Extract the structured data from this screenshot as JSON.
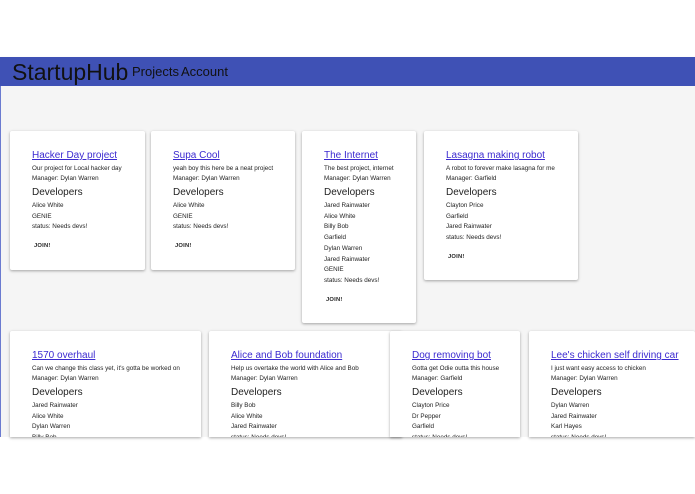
{
  "navbar": {
    "brand": "StartupHub",
    "links": [
      "Projects",
      "Account"
    ],
    "color": "#3f51b5"
  },
  "projects": [
    {
      "title": "Hacker Day project",
      "description": "Our project for Local hacker day",
      "manager": "Manager: Dylan Warren",
      "developers_heading": "Developers",
      "developers": [
        "Alice White",
        "GENIE"
      ],
      "status": "status: Needs devs!",
      "join_label": "JOIN!"
    },
    {
      "title": "Supa Cool",
      "description": "yeah boy this here be a neat project",
      "manager": "Manager: Dylan Warren",
      "developers_heading": "Developers",
      "developers": [
        "Alice White",
        "GENIE"
      ],
      "status": "status: Needs devs!",
      "join_label": "JOIN!"
    },
    {
      "title": "The Internet",
      "description": "The best project, internet",
      "manager": "Manager: Dylan Warren",
      "developers_heading": "Developers",
      "developers": [
        "Jared Rainwater",
        "Alice White",
        "Billy Bob",
        "Garfield",
        "Dylan Warren",
        "Jared Rainwater",
        "GENIE"
      ],
      "status": "status: Needs devs!",
      "join_label": "JOIN!"
    },
    {
      "title": "Lasagna making robot",
      "description": "A robot to forever make lasagna for me",
      "manager": "Manager: Garfield",
      "developers_heading": "Developers",
      "developers": [
        "Clayton Price",
        "Garfield",
        "Jared Rainwater"
      ],
      "status": "status: Needs devs!",
      "join_label": "JOIN!"
    },
    {
      "title": "1570 overhaul",
      "description": "Can we change this class yet, it's gotta be worked on",
      "manager": "Manager: Dylan Warren",
      "developers_heading": "Developers",
      "developers": [
        "Jared Rainwater",
        "Alice White",
        "Dylan Warren",
        "Billy Bob"
      ],
      "status": "",
      "join_label": ""
    },
    {
      "title": "Alice and Bob foundation",
      "description": "Help us overtake the world with Alice and Bob",
      "manager": "Manager: Dylan Warren",
      "developers_heading": "Developers",
      "developers": [
        "Billy Bob",
        "Alice White",
        "Jared Rainwater"
      ],
      "status": "status: Needs devs!",
      "join_label": ""
    },
    {
      "title": "Dog removing bot",
      "description": "Gotta get Odie outta this house",
      "manager": "Manager: Garfield",
      "developers_heading": "Developers",
      "developers": [
        "Clayton Price",
        "Dr Pepper",
        "Garfield"
      ],
      "status": "status: Needs devs!",
      "join_label": ""
    },
    {
      "title": "Lee's chicken self driving car",
      "description": "I just want easy access to chicken",
      "manager": "Manager: Dylan Warren",
      "developers_heading": "Developers",
      "developers": [
        "Dylan Warren",
        "Jared Rainwater",
        "Karl Hayes"
      ],
      "status": "status: Needs devs!",
      "join_label": ""
    }
  ]
}
